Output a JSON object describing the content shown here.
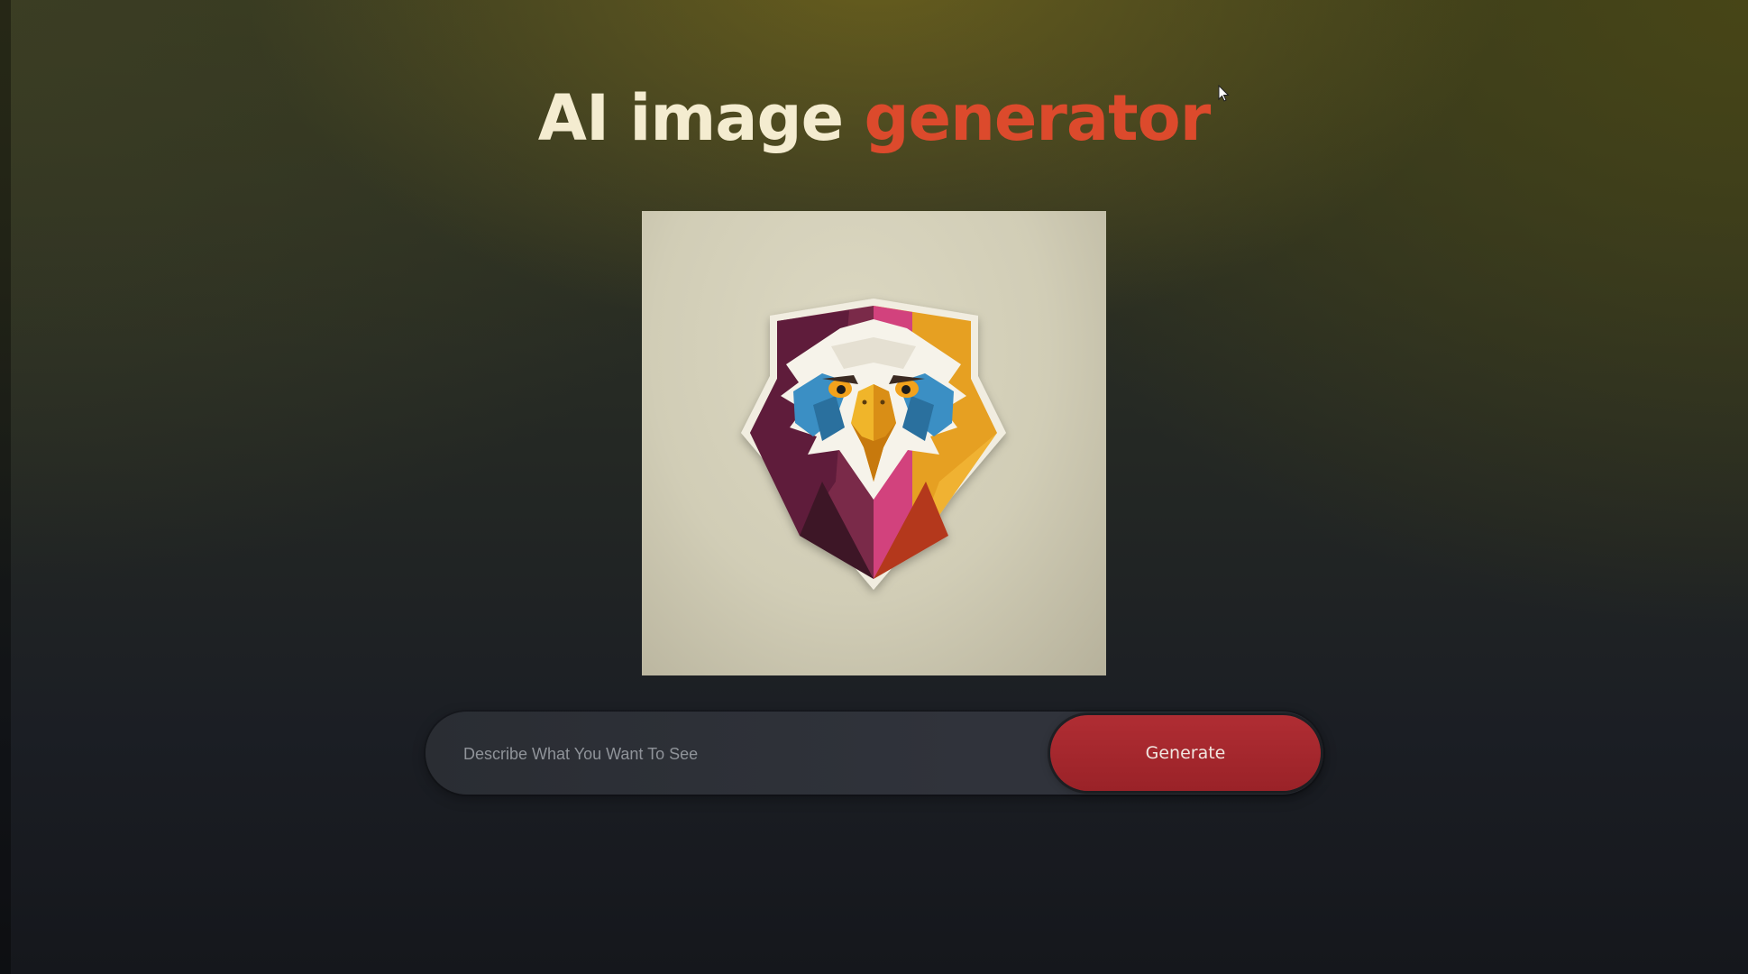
{
  "header": {
    "title_main": "AI image",
    "title_accent": "generator"
  },
  "image": {
    "alt": "eagle shield logo"
  },
  "prompt": {
    "placeholder": "Describe What You Want To See",
    "value": ""
  },
  "actions": {
    "generate_label": "Generate"
  },
  "colors": {
    "title_main": "#f4ecd0",
    "title_accent": "#dc4a2c",
    "button": "#a8272e",
    "card_bg": "#d3cfb8"
  }
}
